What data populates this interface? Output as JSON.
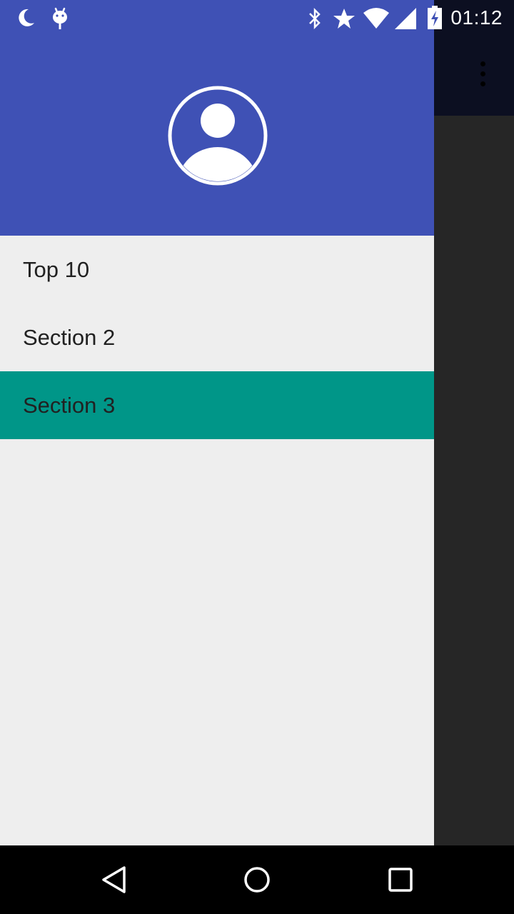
{
  "status_bar": {
    "time": "01:12",
    "left_icons": [
      "moon-icon",
      "android-debug-icon"
    ],
    "right_icons": [
      "bluetooth-icon",
      "star-icon",
      "wifi-icon",
      "cell-signal-icon",
      "battery-charging-icon"
    ]
  },
  "drawer": {
    "header_color": "#3f51b5",
    "avatar_icon": "account-circle-icon",
    "items": [
      {
        "label": "Top 10",
        "selected": false
      },
      {
        "label": "Section 2",
        "selected": false
      },
      {
        "label": "Section 3",
        "selected": true
      }
    ],
    "selected_color": "#009688"
  },
  "app_bar": {
    "menu_icon": "overflow-menu-icon"
  },
  "nav_bar": {
    "buttons": [
      "back-icon",
      "home-icon",
      "recents-icon"
    ]
  }
}
